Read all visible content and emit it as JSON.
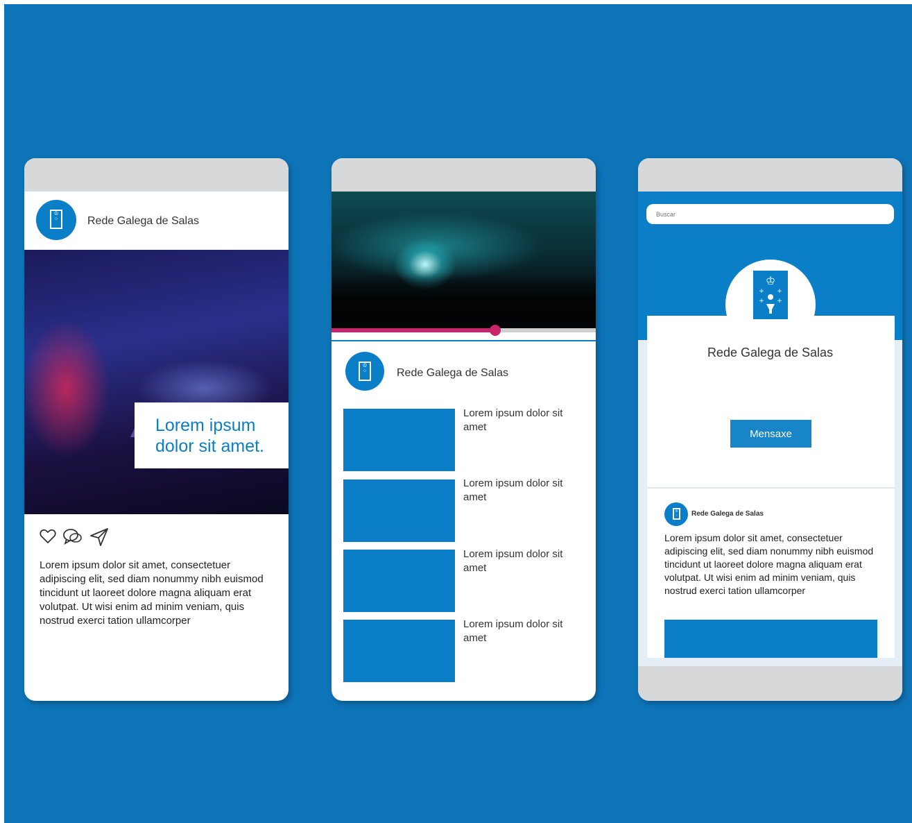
{
  "feed_post": {
    "account_name": "Rede Galega de Salas",
    "overlay_text_line1": "Lorem ipsum",
    "overlay_text_line2": "dolor sit amet.",
    "actions": [
      "like-icon",
      "comment-icon",
      "share-icon"
    ],
    "caption": "Lorem ipsum dolor sit amet, consectetuer adipiscing elit, sed diam nonummy nibh euismod tincidunt ut laoreet dolore magna aliquam erat volutpat. Ut wisi enim ad minim veniam, quis nostrud exerci tation ullamcorper"
  },
  "video_page": {
    "progress": 0.62,
    "account_name": "Rede Galega de Salas",
    "items": [
      {
        "label": "Lorem ipsum dolor sit amet"
      },
      {
        "label": "Lorem ipsum dolor sit amet"
      },
      {
        "label": "Lorem ipsum dolor sit amet"
      },
      {
        "label": "Lorem ipsum dolor sit amet"
      }
    ]
  },
  "profile_page": {
    "search_placeholder": "Buscar",
    "profile_name": "Rede Galega de Salas",
    "message_button": "Mensaxe",
    "post_author": "Rede Galega de Salas",
    "post_text": "Lorem ipsum dolor sit amet, consectetuer adipiscing elit, sed diam nonummy nibh euismod tincidunt ut laoreet dolore magna aliquam erat volutpat. Ut wisi enim ad minim veniam, quis nostrud exerci tation ullamcorper"
  },
  "colors": {
    "background": "#0e74b8",
    "brand_blue": "#0a7fc8",
    "progress_pink": "#c8246a",
    "bar_grey": "#d6d8d9"
  }
}
